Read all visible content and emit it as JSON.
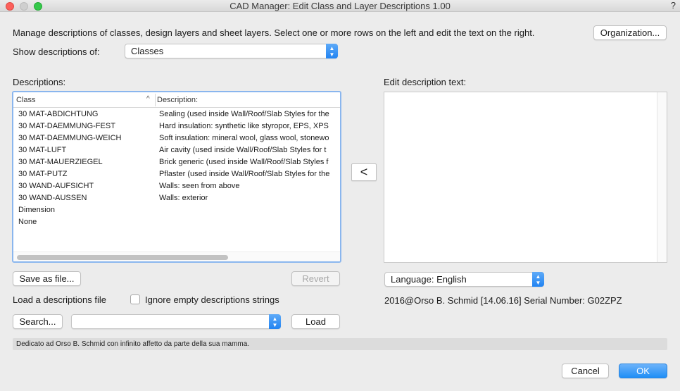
{
  "window": {
    "title": "CAD Manager: Edit Class and Layer Descriptions 1.00",
    "help_glyph": "?"
  },
  "intro_text": "Manage descriptions of classes, design layers and sheet layers. Select one or more rows on the left and edit the text on the right.",
  "organization_button": "Organization...",
  "show_descriptions": {
    "label": "Show descriptions of:",
    "value": "Classes"
  },
  "descriptions_label": "Descriptions:",
  "table": {
    "columns": [
      "Class",
      "Description:"
    ],
    "sort_glyph": "^",
    "rows": [
      {
        "cls": "30 MAT-ABDICHTUNG",
        "desc": "Sealing (used inside Wall/Roof/Slab Styles for the"
      },
      {
        "cls": "30 MAT-DAEMMUNG-FEST",
        "desc": "Hard insulation: synthetic like styropor, EPS, XPS"
      },
      {
        "cls": "30 MAT-DAEMMUNG-WEICH",
        "desc": "Soft insulation: mineral wool, glass wool, stonewo"
      },
      {
        "cls": "30 MAT-LUFT",
        "desc": "Air cavity (used inside Wall/Roof/Slab Styles for t"
      },
      {
        "cls": "30 MAT-MAUERZIEGEL",
        "desc": "Brick generic (used inside Wall/Roof/Slab Styles f"
      },
      {
        "cls": "30 MAT-PUTZ",
        "desc": "Pflaster (used inside Wall/Roof/Slab Styles for the"
      },
      {
        "cls": "30 WAND-AUFSICHT",
        "desc": "Walls: seen from above"
      },
      {
        "cls": "30 WAND-AUSSEN",
        "desc": "Walls: exterior"
      },
      {
        "cls": "Dimension",
        "desc": ""
      },
      {
        "cls": "None",
        "desc": ""
      }
    ]
  },
  "transfer_button": "<",
  "edit_label": "Edit description text:",
  "edit_text": "",
  "save_button": "Save as file...",
  "revert_button": "Revert",
  "language": {
    "value": "Language: English"
  },
  "load_file_label": "Load a descriptions file",
  "ignore_empty_label": "Ignore empty descriptions strings",
  "ignore_empty_checked": false,
  "credit": "2016@Orso B. Schmid [14.06.16]  Serial Number: G02ZPZ",
  "search_button": "Search...",
  "file_path_value": "",
  "load_button": "Load",
  "status_text": "Dedicato ad Orso B. Schmid con infinito affetto da parte della sua mamma.",
  "cancel_button": "Cancel",
  "ok_button": "OK",
  "colors": {
    "accent": "#1f8ef6",
    "focus_ring": "#8ab6ee",
    "close": "#fc605b",
    "maximize": "#34c84a"
  }
}
